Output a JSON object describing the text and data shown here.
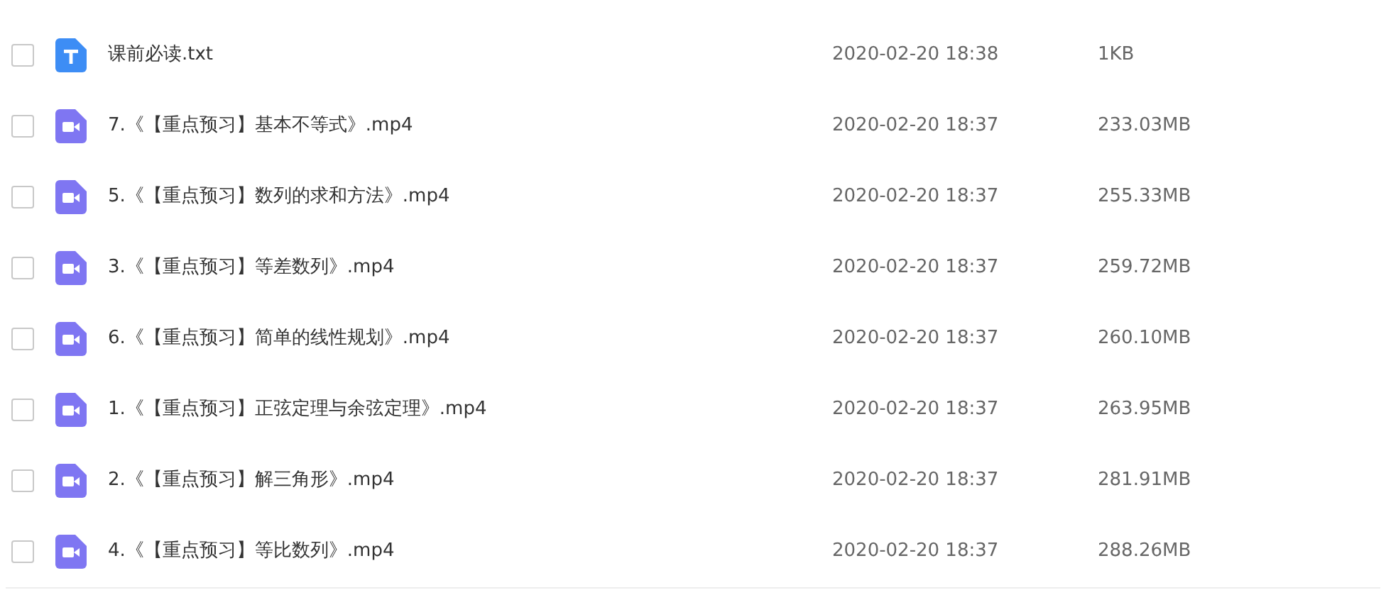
{
  "files": [
    {
      "kind": "txt",
      "name": "课前必读.txt",
      "modified": "2020-02-20 18:38",
      "size": "1KB",
      "checked": false
    },
    {
      "kind": "video",
      "name": "7.《【重点预习】基本不等式》.mp4",
      "modified": "2020-02-20 18:37",
      "size": "233.03MB",
      "checked": false
    },
    {
      "kind": "video",
      "name": "5.《【重点预习】数列的求和方法》.mp4",
      "modified": "2020-02-20 18:37",
      "size": "255.33MB",
      "checked": false
    },
    {
      "kind": "video",
      "name": "3.《【重点预习】等差数列》.mp4",
      "modified": "2020-02-20 18:37",
      "size": "259.72MB",
      "checked": false
    },
    {
      "kind": "video",
      "name": "6.《【重点预习】简单的线性规划》.mp4",
      "modified": "2020-02-20 18:37",
      "size": "260.10MB",
      "checked": false
    },
    {
      "kind": "video",
      "name": "1.《【重点预习】正弦定理与余弦定理》.mp4",
      "modified": "2020-02-20 18:37",
      "size": "263.95MB",
      "checked": false
    },
    {
      "kind": "video",
      "name": "2.《【重点预习】解三角形》.mp4",
      "modified": "2020-02-20 18:37",
      "size": "281.91MB",
      "checked": false
    },
    {
      "kind": "video",
      "name": "4.《【重点预习】等比数列》.mp4",
      "modified": "2020-02-20 18:37",
      "size": "288.26MB",
      "checked": false
    }
  ]
}
